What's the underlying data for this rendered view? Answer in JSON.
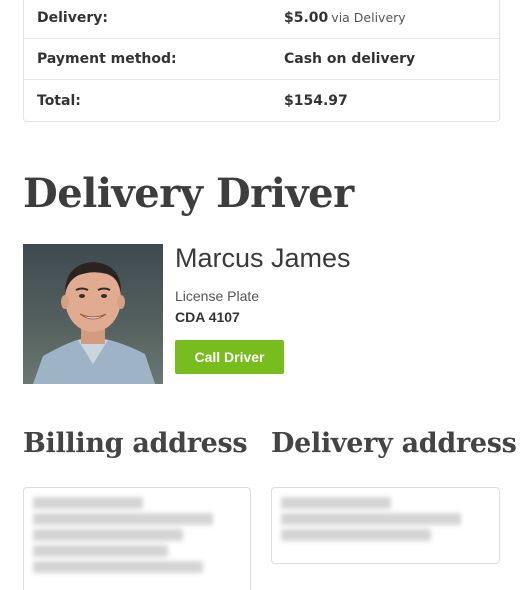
{
  "order_totals": [
    {
      "label": "Delivery:",
      "value": "$5.00",
      "note": "via Delivery"
    },
    {
      "label": "Payment method:",
      "value": "Cash on delivery",
      "note": ""
    },
    {
      "label": "Total:",
      "value": "$154.97",
      "note": ""
    }
  ],
  "driver": {
    "heading": "Delivery Driver",
    "name": "Marcus James",
    "plate_label": "License Plate",
    "plate_value": "CDA 4107",
    "call_button": "Call Driver",
    "call_button_color": "#77bd1e"
  },
  "billing": {
    "heading": "Billing address"
  },
  "delivery": {
    "heading": "Delivery address"
  }
}
